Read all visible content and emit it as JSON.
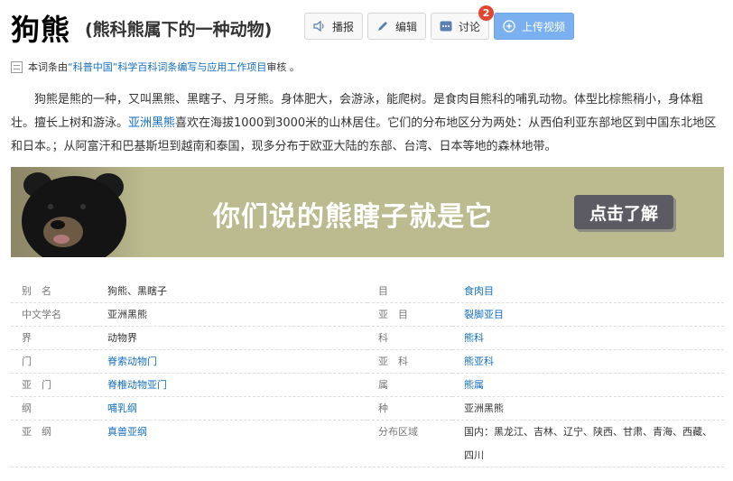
{
  "header": {
    "title": "狗熊",
    "subtitle": "(熊科熊属下的一种动物)",
    "buttons": {
      "broadcast": "播报",
      "edit": "编辑",
      "discuss": "讨论",
      "discuss_badge": "2",
      "upload": "上传视频"
    }
  },
  "review": {
    "prefix": "本词条由",
    "link": "“科普中国”科学百科词条编写与应用工作项目",
    "suffix": " 审核 。"
  },
  "summary": {
    "part1": "狗熊是熊的一种，又叫黑熊、黑瞎子、月牙熊。身体肥大，会游泳，能爬树。是食肉目熊科的哺乳动物。体型比棕熊稍小，身体粗壮。擅长上树和游泳。",
    "link": "亚洲黑熊",
    "part2": "喜欢在海拔1000到3000米的山林居住。它们的分布地区分为两处：从西伯利亚东部地区到中国东北地区和日本。；从阿富汗和巴基斯坦到越南和泰国，现多分布于欧亚大陆的东部、台湾、日本等地的森林地带。"
  },
  "banner": {
    "text": "你们说的熊瞎子就是它",
    "button": "点击了解"
  },
  "info": {
    "left": [
      {
        "label": "别　名",
        "value": "狗熊、黑瞎子",
        "link": false
      },
      {
        "label": "中文学名",
        "value": "亚洲黑熊",
        "link": false
      },
      {
        "label": "界",
        "value": "动物界",
        "link": false
      },
      {
        "label": "门",
        "value": "脊索动物门",
        "link": true
      },
      {
        "label": "亚　门",
        "value": "脊椎动物亚门",
        "link": true
      },
      {
        "label": "纲",
        "value": "哺乳纲",
        "link": true
      },
      {
        "label": "亚　纲",
        "value": "真兽亚纲",
        "link": true
      }
    ],
    "right": [
      {
        "label": "目",
        "value": "食肉目",
        "link": true
      },
      {
        "label": "亚　目",
        "value": "裂脚亚目",
        "link": true
      },
      {
        "label": "科",
        "value": "熊科",
        "link": true
      },
      {
        "label": "亚　科",
        "value": "熊亚科",
        "link": true
      },
      {
        "label": "属",
        "value": "熊属",
        "link": true
      },
      {
        "label": "种",
        "value": "亚洲黑熊",
        "link": false
      },
      {
        "label": "分布区域",
        "value": "国内：黑龙江、吉林、辽宁、陕西、甘肃、青海、西藏、四川",
        "link": false
      }
    ]
  },
  "colors": {
    "link": "#136ec2",
    "upload_button": "#7ab0f0",
    "banner_bg": "#bcbb8f",
    "badge": "#e2462f"
  },
  "icons": [
    "speaker-icon",
    "pencil-icon",
    "chat-icon",
    "plus-circle-icon",
    "document-icon"
  ]
}
